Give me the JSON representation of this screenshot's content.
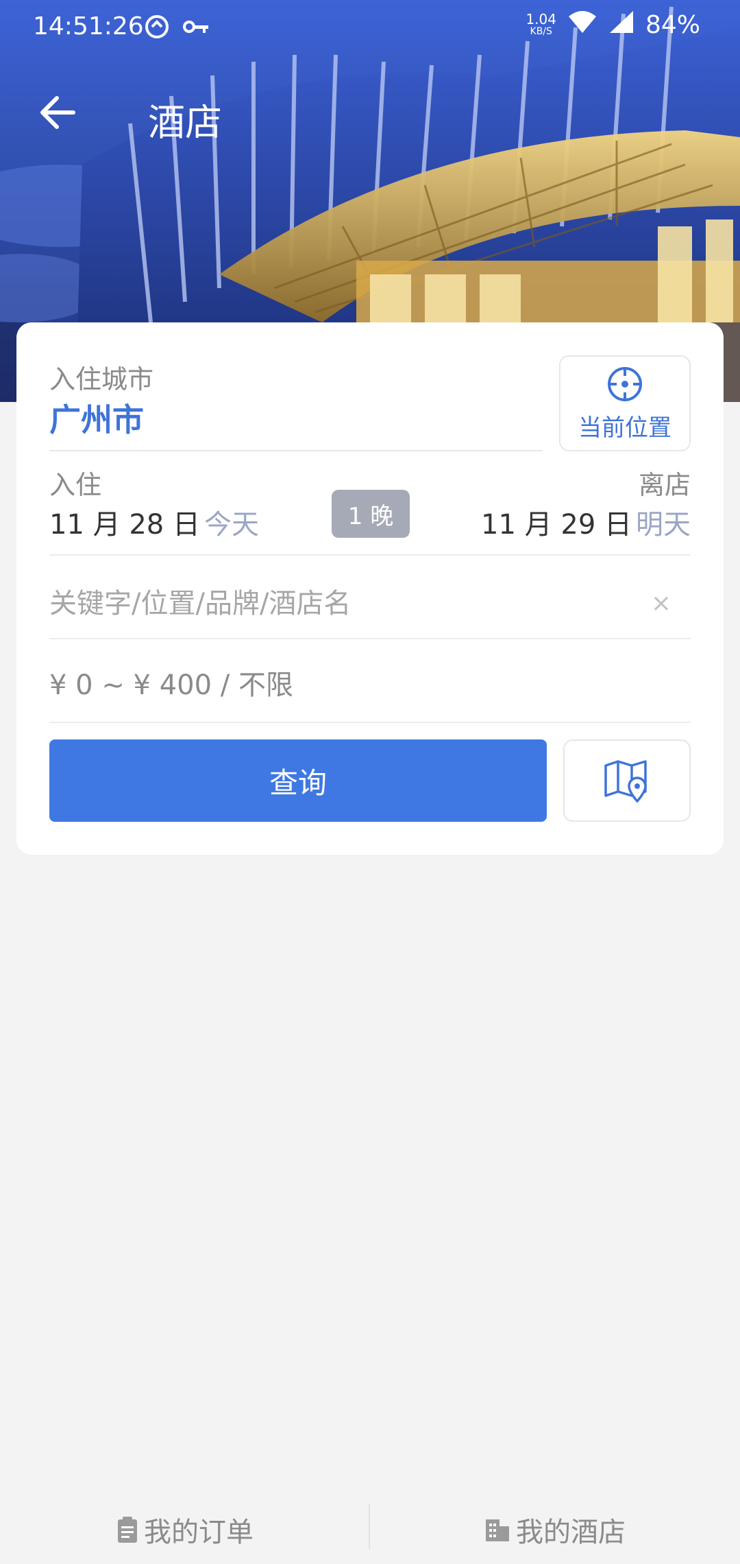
{
  "status_bar": {
    "time": "14:51:26",
    "net_speed": "1.04",
    "net_unit": "KB/S",
    "battery": "84%"
  },
  "header": {
    "title": "酒店"
  },
  "search": {
    "city_label": "入住城市",
    "city_value": "广州市",
    "locate_label": "当前位置",
    "checkin_label": "入住",
    "checkin_date": "11 月 28 日",
    "checkin_relative": "今天",
    "nights": "1 晚",
    "checkout_label": "离店",
    "checkout_date": "11 月 29 日",
    "checkout_relative": "明天",
    "keyword_placeholder": "关键字/位置/品牌/酒店名",
    "clear_glyph": "×",
    "price_range": "¥ 0 ~ ¥ 400 / 不限",
    "search_button": "查询"
  },
  "bottom_nav": {
    "orders": "我的订单",
    "hotels": "我的酒店"
  },
  "colors": {
    "accent": "#3f78e2",
    "city_text": "#3f74d8",
    "badge": "#a6aab6",
    "background": "#f3f3f3"
  },
  "icons": {
    "back": "arrow-left-icon",
    "locate": "crosshair-icon",
    "map": "map-pin-icon",
    "clear": "close-icon",
    "orders": "clipboard-icon",
    "hotels": "building-icon"
  }
}
